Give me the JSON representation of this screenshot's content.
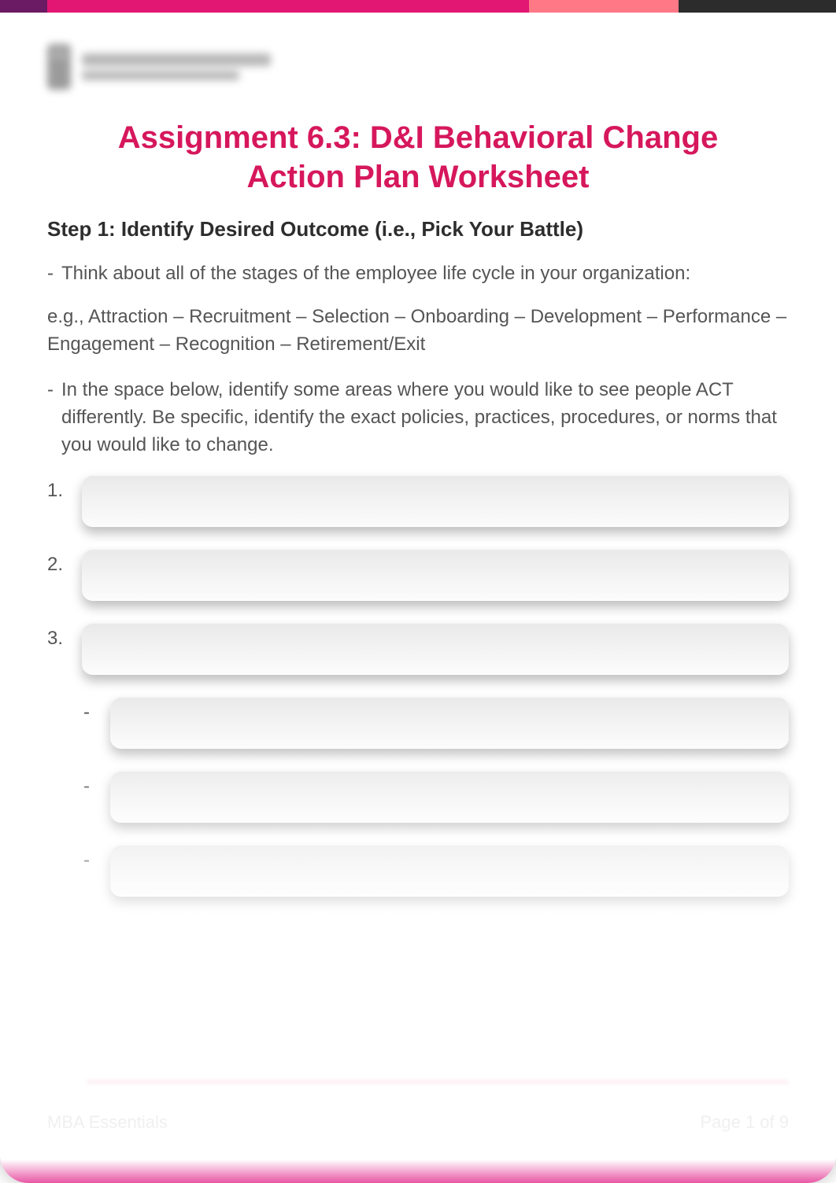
{
  "title": "Assignment 6.3: D&I Behavioral Change Action Plan Worksheet",
  "step1_heading": "Step 1: Identify Desired Outcome (i.e., Pick Your Battle)",
  "bullet1": "Think about all of the stages of the employee life cycle in your organization:",
  "example_line": "e.g., Attraction – Recruitment – Selection – Onboarding – Development – Performance – Engagement – Recognition – Retirement/Exit",
  "bullet2": "In the space below, identify some areas where you would like to see people ACT differently. Be specific, identify the exact policies, practices, procedures, or norms that you would like to change.",
  "dash": "-",
  "numbered": [
    {
      "label": "1.",
      "value": ""
    },
    {
      "label": "2.",
      "value": ""
    },
    {
      "label": "3.",
      "value": ""
    }
  ],
  "sub_items": [
    {
      "label": "-",
      "value": ""
    },
    {
      "label": "-",
      "value": ""
    },
    {
      "label": "-",
      "value": ""
    }
  ],
  "footer_left": "MBA Essentials",
  "footer_right": "Page 1 of 9"
}
